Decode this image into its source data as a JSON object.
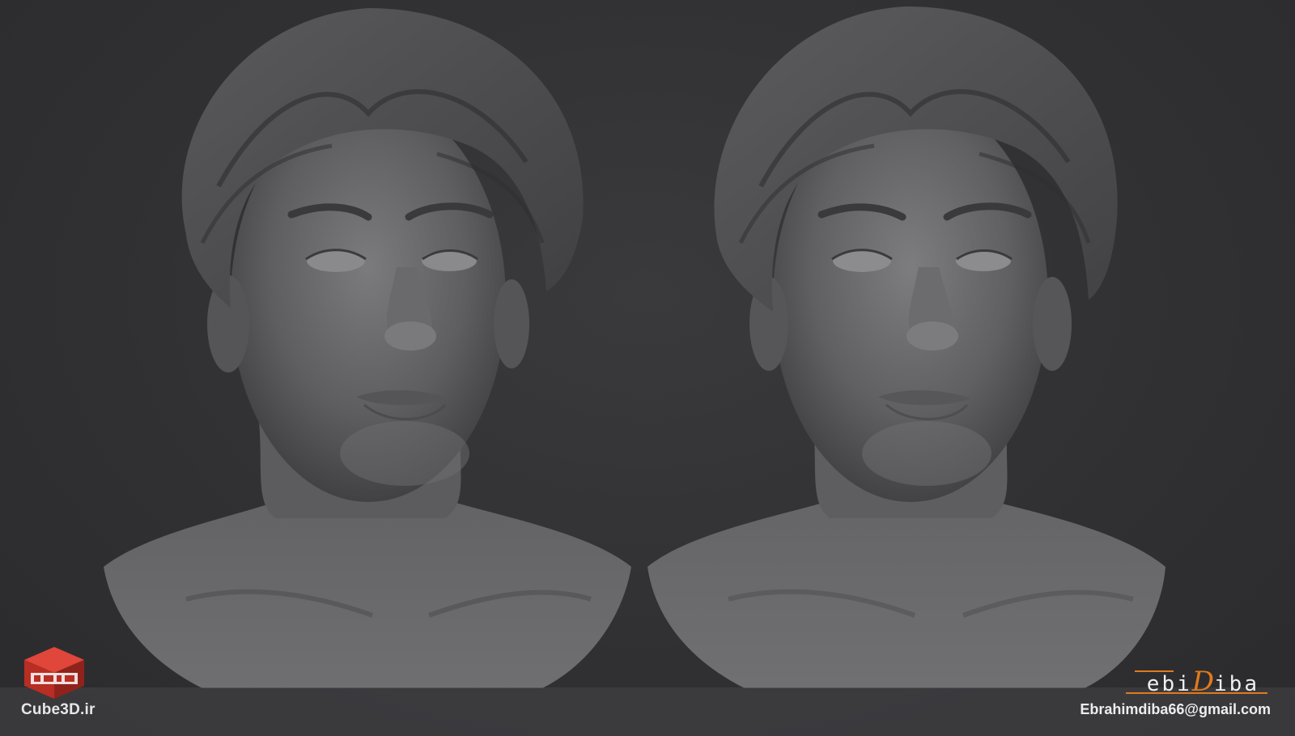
{
  "image": {
    "background_color": "#323234",
    "sculpt_color": "#6c6c6e"
  },
  "watermark": {
    "logo_icon": "cube3d-logo-icon",
    "logo_color": "#c8352c",
    "site_label": "Cube3D.ir"
  },
  "signature": {
    "prefix": "ebi",
    "accent_letter": "D",
    "suffix": "iba",
    "accent_color": "#e07a1c",
    "email": "Ebrahimdiba66@gmail.com"
  }
}
